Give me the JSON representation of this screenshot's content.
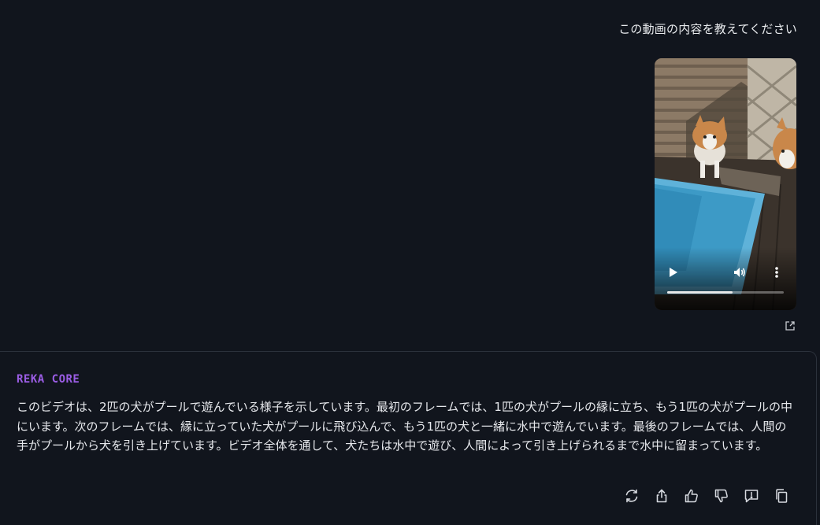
{
  "user_message": {
    "text": "この動画の内容を教えてください"
  },
  "video": {
    "progress": 0.56,
    "controls": {
      "play_icon": "play-icon",
      "volume_icon": "volume-icon",
      "more_icon": "more-vertical-icon"
    }
  },
  "edit_icon": "open-external-icon",
  "response": {
    "model_name": "REKA CORE",
    "text": "このビデオは、2匹の犬がプールで遊んでいる様子を示しています。最初のフレームでは、1匹の犬がプールの縁に立ち、もう1匹の犬がプールの中にいます。次のフレームでは、縁に立っていた犬がプールに飛び込んで、もう1匹の犬と一緒に水中で遊んでいます。最後のフレームでは、人間の手がプールから犬を引き上げています。ビデオ全体を通して、犬たちは水中で遊び、人間によって引き上げられるまで水中に留まっています。",
    "actions": [
      "regenerate-icon",
      "share-icon",
      "thumbs-up-icon",
      "thumbs-down-icon",
      "feedback-icon",
      "copy-icon"
    ]
  },
  "colors": {
    "background": "#11151d",
    "accent": "#9b5de5",
    "text": "#e6e8ec"
  }
}
